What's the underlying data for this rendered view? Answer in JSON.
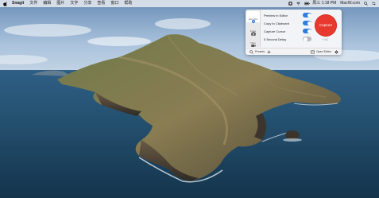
{
  "menubar": {
    "app_name": "Snagit",
    "items": [
      "文件",
      "编辑",
      "图片",
      "文字",
      "分享",
      "查看",
      "窗口",
      "帮助"
    ],
    "date": "周三 1:18 PM",
    "site": "MacW.com"
  },
  "panel": {
    "modes": [
      {
        "label": "All-in-One",
        "icon": "crosshair-icon",
        "active": true
      },
      {
        "label": "Image",
        "icon": "camera-icon",
        "active": false
      },
      {
        "label": "Video",
        "icon": "video-camera-icon",
        "active": false
      }
    ],
    "options": [
      {
        "label": "Preview in Editor",
        "on": true
      },
      {
        "label": "Copy to Clipboard",
        "on": true
      },
      {
        "label": "Capture Cursor",
        "on": true
      },
      {
        "label": "5 Second Delay",
        "on": false
      }
    ],
    "capture_label": "Capture",
    "hotkey": "⌃⇧C",
    "footer": {
      "presets": "Presets",
      "open_editor": "Open Editor"
    }
  },
  "colors": {
    "capture_red": "#e8392f",
    "toggle_on": "#2f7de1",
    "toggle_off": "#b9b9be"
  }
}
